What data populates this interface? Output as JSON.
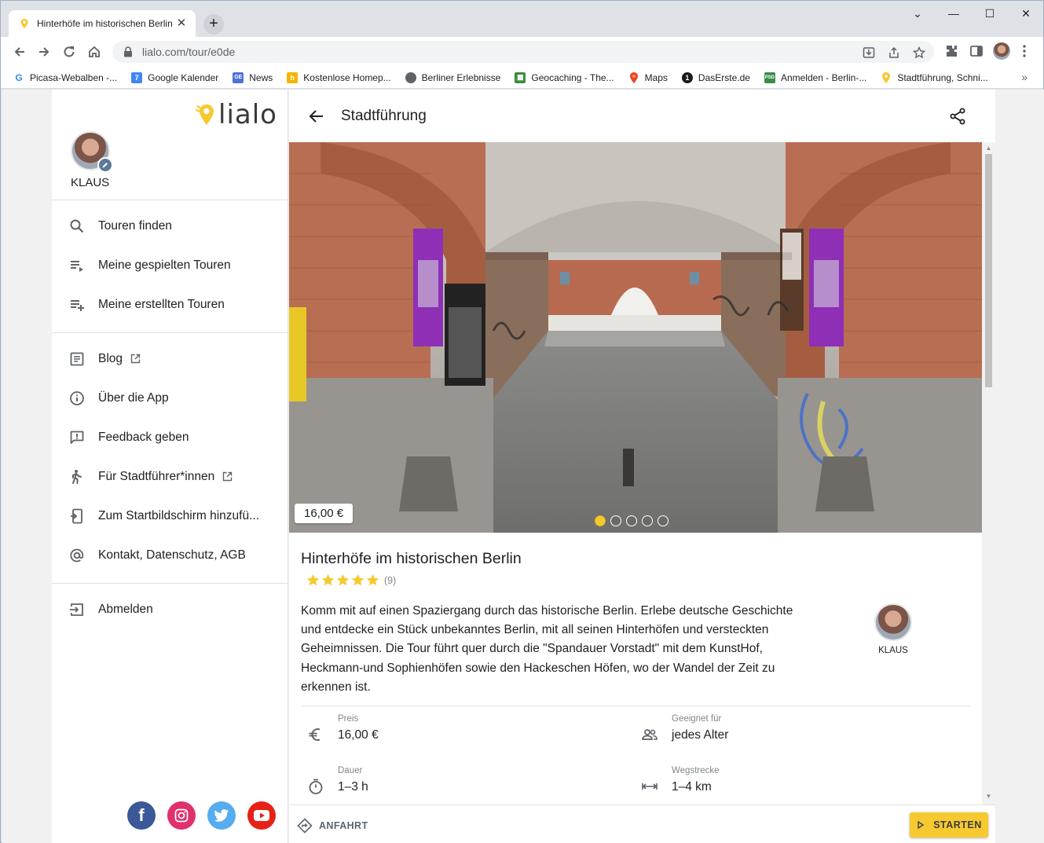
{
  "browser": {
    "tab_title": "Hinterhöfe im historischen Berlin",
    "url": "lialo.com/tour/e0de",
    "bookmarks": [
      {
        "label": "Picasa-Webalben -...",
        "icon": "google-icon",
        "color": "#ffffff"
      },
      {
        "label": "Google Kalender",
        "icon": "calendar-icon",
        "color": "#4285f4"
      },
      {
        "label": "News",
        "icon": "news-icon",
        "color": "#4e72d8"
      },
      {
        "label": "Kostenlose Homep...",
        "icon": "homepage-icon",
        "color": "#f4b400"
      },
      {
        "label": "Berliner Erlebnisse",
        "icon": "globe-icon",
        "color": "#5f6368"
      },
      {
        "label": "Geocaching - The...",
        "icon": "geocaching-icon",
        "color": "#3a8d3a"
      },
      {
        "label": "Maps",
        "icon": "maps-icon",
        "color": "#ea4335"
      },
      {
        "label": "DasErste.de",
        "icon": "daserste-icon",
        "color": "#1a1a1a"
      },
      {
        "label": "Anmelden - Berlin-...",
        "icon": "bank-icon",
        "color": "#3c8c4a"
      },
      {
        "label": "Stadtführung, Schni...",
        "icon": "lialo-icon",
        "color": "#f7c931"
      }
    ]
  },
  "sidebar": {
    "logo_text": "lialo",
    "user_name": "KLAUS",
    "menu": [
      {
        "label": "Touren finden",
        "icon": "search-icon"
      },
      {
        "label": "Meine gespielten Touren",
        "icon": "playlist-play-icon"
      },
      {
        "label": "Meine erstellten Touren",
        "icon": "playlist-add-icon"
      },
      {
        "label": "Blog",
        "icon": "article-icon",
        "external": true
      },
      {
        "label": "Über die App",
        "icon": "info-icon"
      },
      {
        "label": "Feedback geben",
        "icon": "feedback-icon"
      },
      {
        "label": "Für Stadtführer*innen",
        "icon": "walking-person-icon",
        "external": true
      },
      {
        "label": "Zum Startbildschirm hinzufü...",
        "icon": "add-to-homescreen-icon"
      },
      {
        "label": "Kontakt, Datenschutz, AGB",
        "icon": "at-icon"
      },
      {
        "label": "Abmelden",
        "icon": "logout-icon"
      }
    ],
    "social": [
      "facebook-icon",
      "instagram-icon",
      "twitter-icon",
      "youtube-icon"
    ]
  },
  "main": {
    "header_title": "Stadtführung",
    "price_tag": "16,00 €",
    "carousel": {
      "count": 5,
      "active": 1
    },
    "tour_title": "Hinterhöfe im historischen Berlin",
    "rating": {
      "stars": 5,
      "count": "(9)"
    },
    "description": "Komm mit auf einen Spaziergang durch das historische Berlin. Erlebe deutsche Geschichte und entdecke ein Stück unbekanntes Berlin, mit all seinen Hinterhöfen und versteckten Geheimnissen. Die Tour führt quer durch die \"Spandauer Vorstadt\" mit dem KunstHof, Heckmann-und Sophienhöfen sowie den Hackeschen Höfen, wo der Wandel der Zeit zu erkennen ist.",
    "guide_name": "KLAUS",
    "facts": {
      "price": {
        "label": "Preis",
        "value": "16,00 €"
      },
      "age": {
        "label": "Geeignet für",
        "value": "jedes Alter"
      },
      "duration": {
        "label": "Dauer",
        "value": "1–3 h"
      },
      "distance": {
        "label": "Wegstrecke",
        "value": "1–4 km"
      }
    },
    "anfahrt_label": "ANFAHRT",
    "start_label": "STARTEN"
  },
  "colors": {
    "accent": "#f7c931",
    "icon_gray": "#5f6368"
  }
}
